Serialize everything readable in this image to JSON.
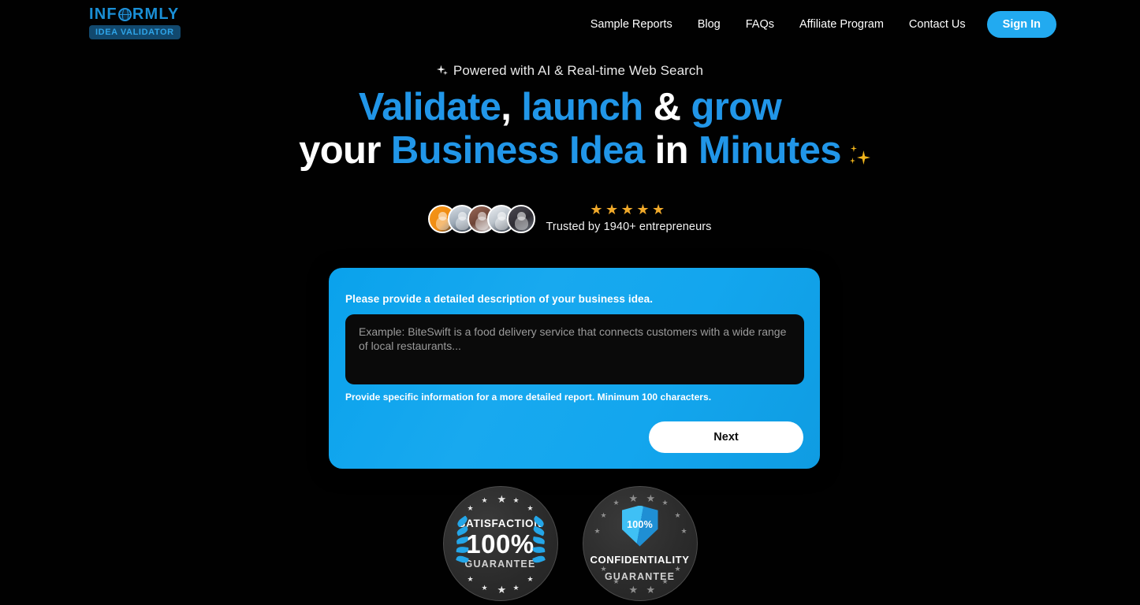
{
  "brand": {
    "name_part_1": "INF",
    "name_part_2": "RMLY",
    "globe_icon": "globe-icon",
    "badge": "IDEA VALIDATOR"
  },
  "nav": {
    "items": [
      {
        "label": "Sample Reports"
      },
      {
        "label": "Blog"
      },
      {
        "label": "FAQs"
      },
      {
        "label": "Affiliate Program"
      },
      {
        "label": "Contact Us"
      }
    ],
    "sign_in": "Sign In"
  },
  "hero": {
    "eyebrow": "Powered with AI & Real-time Web Search",
    "eyebrow_icon": "sparkle-icon",
    "line1_a": "Validate",
    "line1_b": ", ",
    "line1_c": "launch",
    "line1_d": " & ",
    "line1_e": "grow",
    "line2_a": "your ",
    "line2_b": "Business Idea",
    "line2_c": " in ",
    "line2_d": "Minutes",
    "sparkle_icon": "sparkle-icon"
  },
  "social_proof": {
    "stars": "★★★★★",
    "star_count": 5,
    "trusted_text": "Trusted by 1940+ entrepreneurs",
    "avatar_count": 5
  },
  "form": {
    "label": "Please provide a detailed description of your business idea.",
    "textarea_value": "",
    "textarea_placeholder": "Example: BiteSwift is a food delivery service that connects customers with a wide range of local restaurants...",
    "help_text": "Provide specific information for a more detailed report. Minimum 100 characters.",
    "next_label": "Next"
  },
  "badges": [
    {
      "title": "SATISFACTION",
      "percent": "100%",
      "subtitle": "GUARANTEE",
      "icon": "laurel-wreath-icon"
    },
    {
      "shield_percent": "100%",
      "title": "CONFIDENTIALITY",
      "subtitle": "GUARANTEE",
      "icon": "shield-icon"
    }
  ],
  "colors": {
    "background": "#010101",
    "accent_blue": "#22aaf0",
    "headline_blue": "#2196e8",
    "star_gold": "#f0a92a",
    "badge_dark_blue": "#12496e"
  }
}
